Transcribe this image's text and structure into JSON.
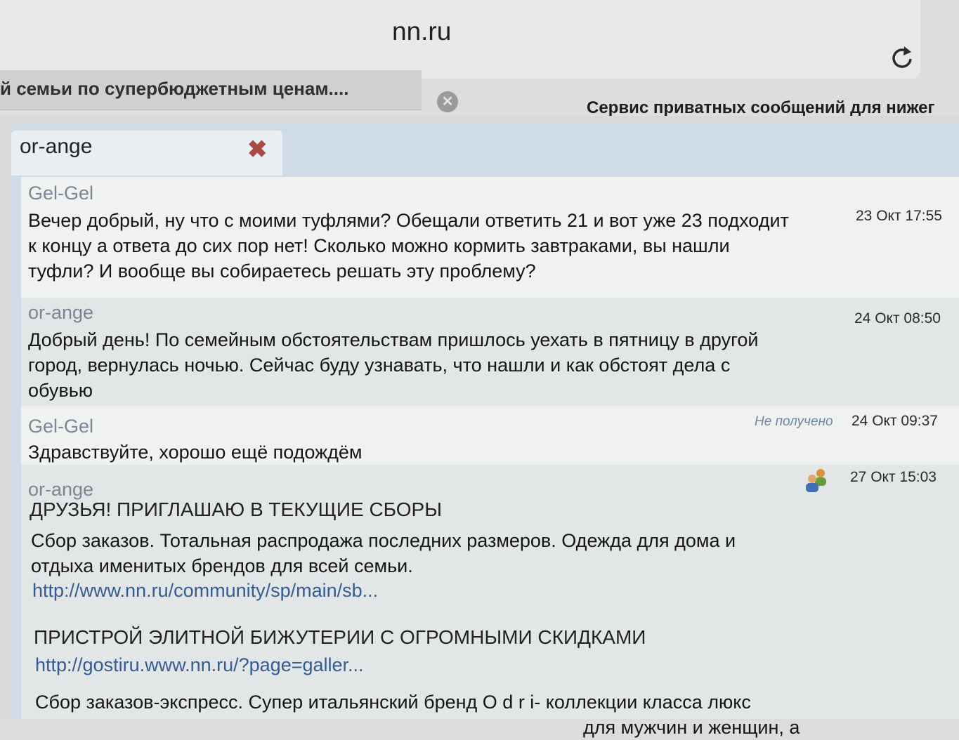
{
  "browser": {
    "url": "nn.ru",
    "reload_icon": "reload-icon",
    "tabs": [
      {
        "label": "й семьи по супербюджетным ценам...."
      },
      {
        "label": "Сервис приватных сообщений для нижег"
      }
    ],
    "tab_close_icon": "close-circle-icon"
  },
  "chat": {
    "tab_label": "or-ange",
    "tab_close_icon": "close-x-icon",
    "messages": [
      {
        "author": "Gel-Gel",
        "time": "23 Окт 17:55",
        "lines": [
          "Вечер добрый, ну что с моими туфлями? Обещали ответить 21 и вот уже 23 подходит",
          "к концу а ответа до сих пор нет! Сколько можно кормить завтраками, вы нашли",
          "туфли? И вообще вы собираетесь решать эту проблему?"
        ]
      },
      {
        "author": "or-ange",
        "time": "24 Окт 08:50",
        "lines": [
          "Добрый день! По семейным обстоятельствам пришлось уехать в пятницу в другой",
          "город, вернулась ночью. Сейчас буду узнавать, что нашли и как обстоят дела с",
          "обувью"
        ]
      },
      {
        "author": "Gel-Gel",
        "status": "Не получено",
        "time": "24 Окт 09:37",
        "lines": [
          "Здравствуйте, хорошо ещё подождём"
        ]
      },
      {
        "author": "or-ange",
        "time": "27 Окт 15:03",
        "icon": "group-users-icon",
        "heading1": "ДРУЗЬЯ! ПРИГЛАШАЮ В ТЕКУЩИЕ СБОРЫ",
        "para1_lines": [
          "Сбор заказов. Тотальная распродажа последних размеров. Одежда для дома и",
          "отдыха именитых брендов для всей семьи."
        ],
        "link1": "http://www.nn.ru/community/sp/main/sb...",
        "heading2": "ПРИСТРОЙ ЭЛИТНОЙ БИЖУТЕРИИ С ОГРОМНЫМИ СКИДКАМИ",
        "link2": "http://gostiru.www.nn.ru/?page=galler...",
        "para2_lines": [
          "Сбор заказов-экспресс. Супер итальянский бренд O d r i- коллекции класса люкс",
          "для мужчин и женщин, а"
        ]
      }
    ]
  }
}
